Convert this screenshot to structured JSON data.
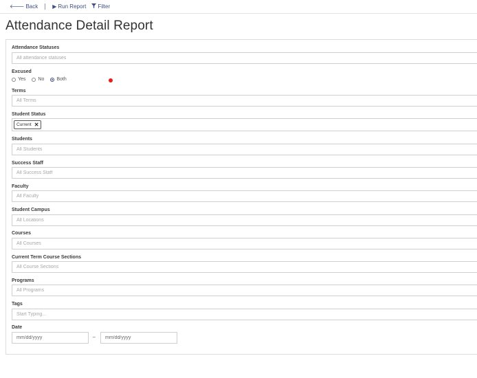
{
  "toolbar": {
    "back_label": "Back",
    "run_report_label": "Run Report",
    "filter_label": "Filter",
    "back_icon": "arrow-left",
    "run_icon": "play",
    "filter_icon": "funnel"
  },
  "page": {
    "title": "Attendance Detail Report"
  },
  "filters": {
    "attendance_statuses": {
      "label": "Attendance Statuses",
      "placeholder": "All attendance statuses"
    },
    "excused": {
      "label": "Excused",
      "options": [
        "Yes",
        "No",
        "Both"
      ],
      "selected": "Both"
    },
    "terms": {
      "label": "Terms",
      "placeholder": "All Terms"
    },
    "student_status": {
      "label": "Student Status",
      "selected_tags": [
        "Current"
      ]
    },
    "students": {
      "label": "Students",
      "placeholder": "All Students"
    },
    "success_staff": {
      "label": "Success Staff",
      "placeholder": "All Success Staff"
    },
    "faculty": {
      "label": "Faculty",
      "placeholder": "All Faculty"
    },
    "student_campus": {
      "label": "Student Campus",
      "placeholder": "All Locations"
    },
    "courses": {
      "label": "Courses",
      "placeholder": "All Courses"
    },
    "current_term_course_sections": {
      "label": "Current Term Course Sections",
      "placeholder": "All Course Sections"
    },
    "programs": {
      "label": "Programs",
      "placeholder": "All Programs"
    },
    "tags": {
      "label": "Tags",
      "placeholder": "Start Typing..."
    },
    "date": {
      "label": "Date",
      "from_placeholder": "mm/dd/yyyy",
      "separator": "–",
      "to_placeholder": "mm/dd/yyyy"
    }
  },
  "colors": {
    "accent": "#3f4f7f",
    "indicator": "#e3201b"
  }
}
